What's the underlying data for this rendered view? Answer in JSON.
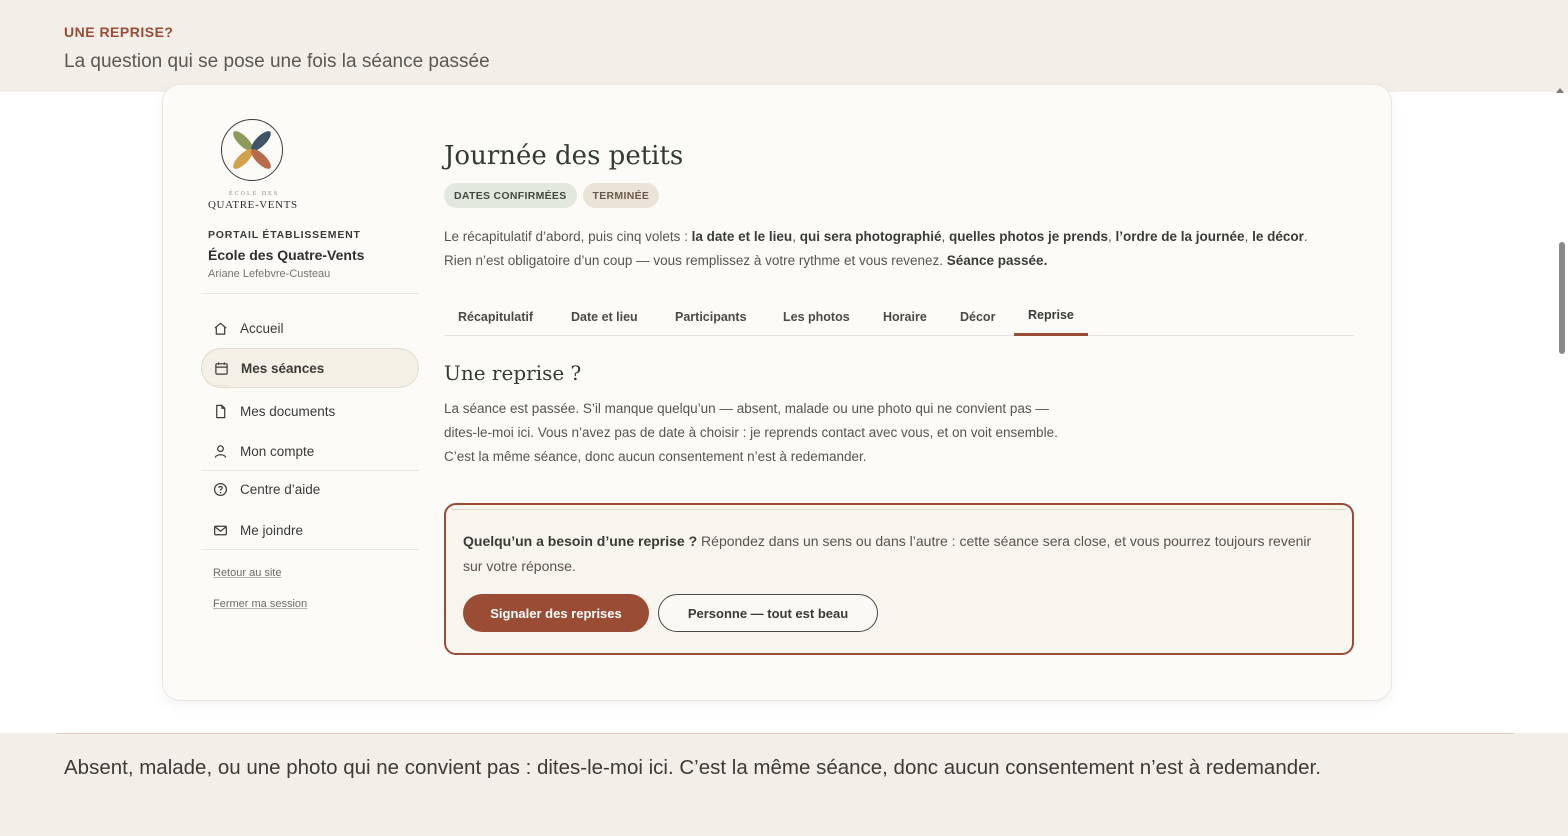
{
  "header": {
    "eyebrow": "UNE REPRISE?",
    "subtitle": "La question qui se pose une fois la séance passée"
  },
  "sidebar": {
    "logo_small": "ÉCOLE DES",
    "logo_name": "QUATRE-VENTS",
    "portal_label": "PORTAIL ÉTABLISSEMENT",
    "school_name": "École des Quatre-Vents",
    "user_name": "Ariane Lefebvre-Custeau",
    "items": [
      {
        "label": "Accueil",
        "icon": "home-icon"
      },
      {
        "label": "Mes séances",
        "icon": "calendar-icon",
        "active": true
      },
      {
        "label": "Mes documents",
        "icon": "document-icon"
      },
      {
        "label": "Mon compte",
        "icon": "user-icon"
      },
      {
        "label": "Centre d’aide",
        "icon": "help-icon"
      },
      {
        "label": "Me joindre",
        "icon": "mail-icon"
      }
    ],
    "footer_links": [
      "Retour au site",
      "Fermer ma session"
    ]
  },
  "main": {
    "title": "Journée des petits",
    "badges": [
      "DATES CONFIRMÉES",
      "TERMINÉE"
    ],
    "intro": {
      "prefix": "Le récapitulatif d’abord, puis cinq volets : ",
      "item1": "la date et le lieu",
      "sep1": ", ",
      "item2": "qui sera photographié",
      "sep2": ", ",
      "item3": "quelles photos je prends",
      "sep3": ", ",
      "item4": "l’ordre de la journée",
      "sep4": ", ",
      "item5": "le décor",
      "middle": ". Rien n’est obligatoire d’un coup — vous remplissez à votre rythme et vous revenez. ",
      "status": "Séance passée."
    },
    "tabs": [
      "Récapitulatif",
      "Date et lieu",
      "Participants",
      "Les photos",
      "Horaire",
      "Décor",
      "Reprise"
    ],
    "active_tab": "Reprise",
    "section_title": "Une reprise ?",
    "section_text": "La séance est passée. S’il manque quelqu’un — absent, malade ou une photo qui ne convient pas — dites-le-moi ici. Vous n’avez pas de date à choisir : je reprends contact avec vous, et on voit ensemble. C’est la même séance, donc aucun consentement n’est à redemander.",
    "reprise": {
      "question": "Quelqu’un a besoin d’une reprise ?",
      "text": " Répondez dans un sens ou dans l’autre : cette séance sera close, et vous pourrez toujours revenir sur votre réponse.",
      "primary_label": "Signaler des reprises",
      "secondary_label": "Personne — tout est beau"
    }
  },
  "footer": {
    "caption": "Absent, malade, ou une photo qui ne convient pas : dites-le-moi ici. C’est la même séance, donc aucun consentement n’est à redemander."
  },
  "colors": {
    "accent": "#9a4c35",
    "band": "#f3eee8",
    "card": "#fcfbf8"
  }
}
